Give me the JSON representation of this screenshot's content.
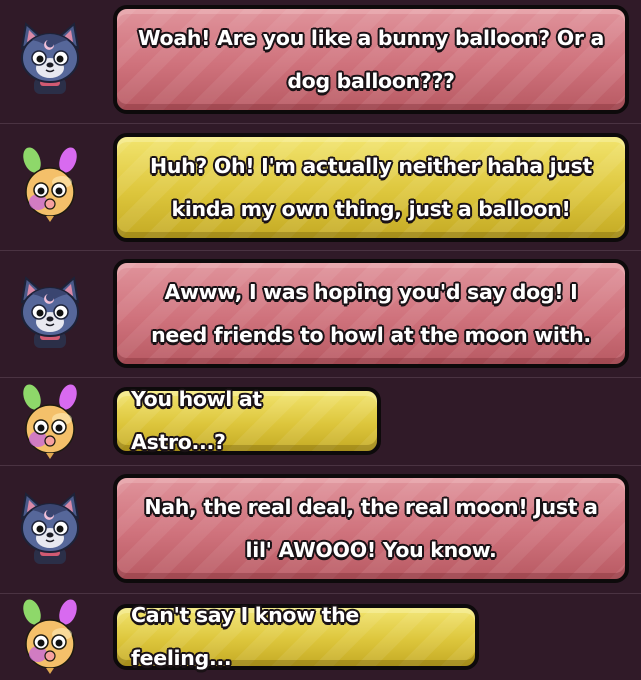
{
  "messages": [
    {
      "speaker": "wolf",
      "text": "Woah! Are you like a bunny balloon? Or a dog balloon???"
    },
    {
      "speaker": "balloon",
      "text": "Huh? Oh! I'm actually neither haha just kinda my own thing, just a balloon!"
    },
    {
      "speaker": "wolf",
      "text": "Awww, I was hoping you'd say dog! I need friends to howl at the moon with."
    },
    {
      "speaker": "balloon",
      "text": "You howl at Astro...?"
    },
    {
      "speaker": "wolf",
      "text": "Nah, the real deal, the real moon! Just a lil' AWOOO! You know."
    },
    {
      "speaker": "balloon",
      "text": "Can't say I know the feeling..."
    }
  ],
  "colors": {
    "background": "#301a28",
    "wolf_bubble": "#cf727c",
    "balloon_bubble": "#ddc63c"
  },
  "icons": {
    "wolf": "wolf-character-icon",
    "balloon": "balloon-character-icon"
  }
}
